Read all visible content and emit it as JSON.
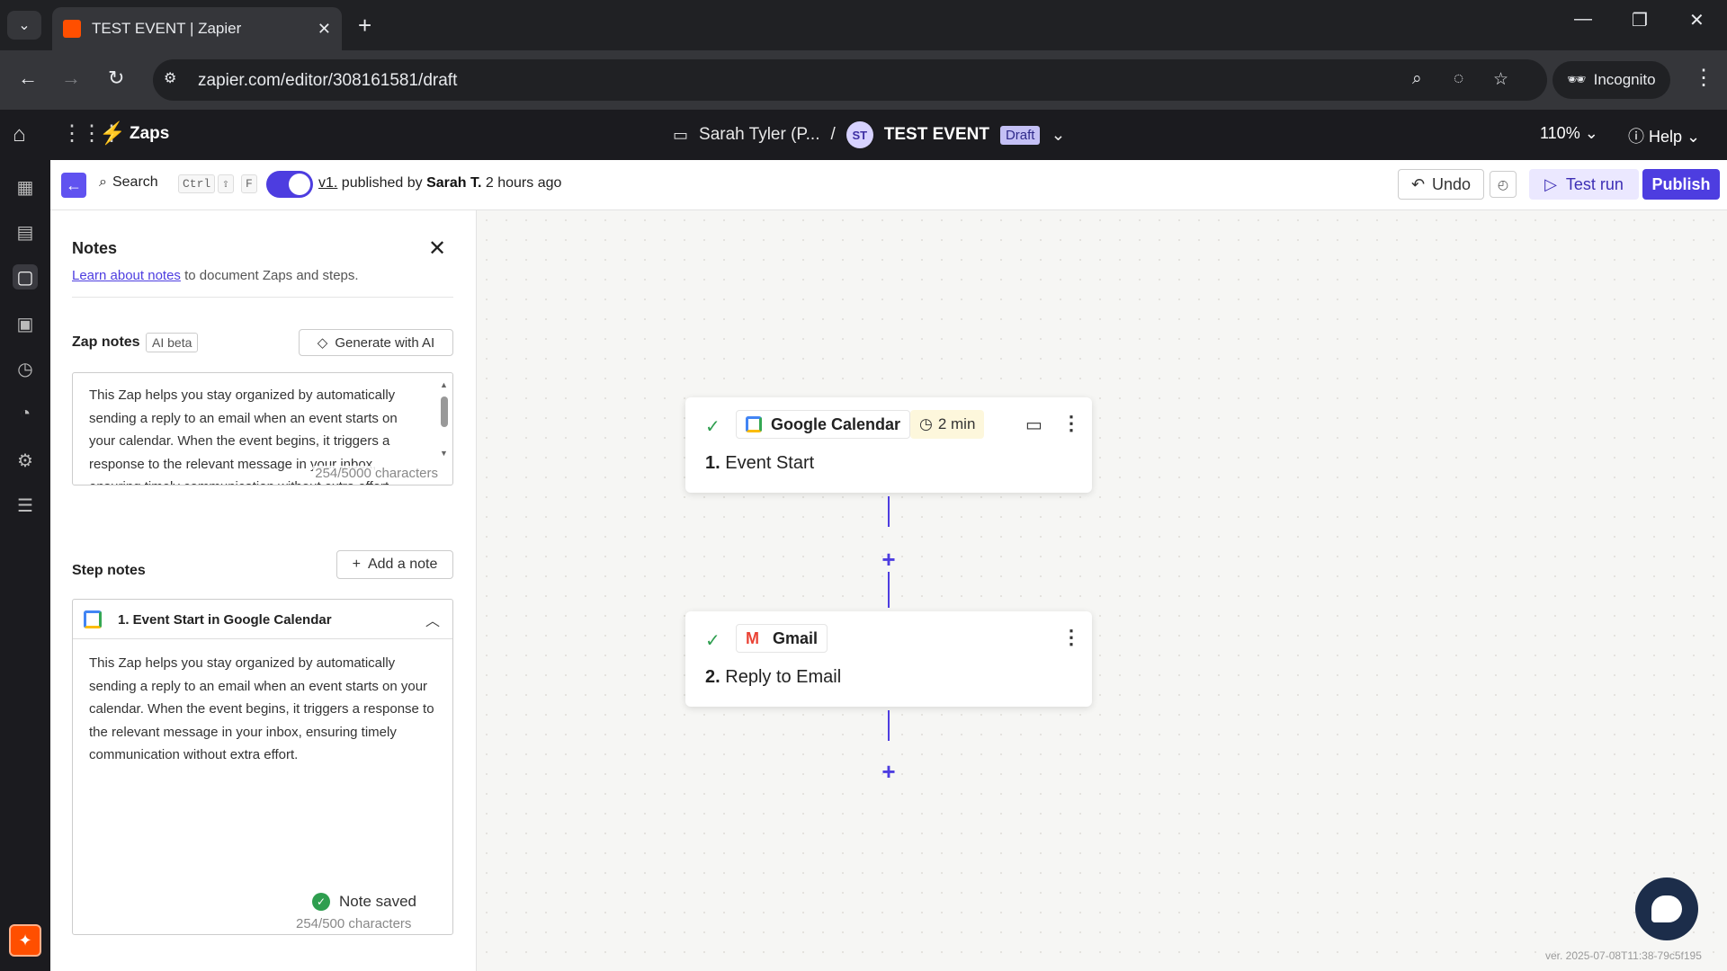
{
  "browser": {
    "tab_title": "TEST EVENT | Zapier",
    "url": "zapier.com/editor/308161581/draft",
    "incognito_label": "Incognito"
  },
  "app_header": {
    "section": "Zaps",
    "folder": "Sarah Tyler (P...",
    "avatar_initials": "ST",
    "zap_name": "TEST EVENT",
    "status_badge": "Draft",
    "zoom": "110%",
    "help": "Help"
  },
  "editor_bar": {
    "search_label": "Search",
    "kbd_ctrl": "Ctrl",
    "kbd_shift": "⇧",
    "kbd_f": "F",
    "version": "v1.",
    "published_by_text": " published by ",
    "publisher": "Sarah T.",
    "time_ago": " 2 hours ago",
    "undo": "Undo",
    "test_run": "Test run",
    "publish": "Publish"
  },
  "notes_panel": {
    "title": "Notes",
    "learn_link": "Learn about notes",
    "learn_suffix": " to document Zaps and steps.",
    "zap_notes_label": "Zap notes",
    "ai_beta": "AI beta",
    "generate_ai": "Generate with AI",
    "zap_note_text": "This Zap helps you stay organized by automatically sending a reply to an email when an event starts on your calendar. When the event begins, it triggers a response to the relevant message in your inbox, ensuring timely communication without extra effort.",
    "zap_note_count": "254/5000 characters",
    "step_notes_label": "Step notes",
    "add_note": "Add a note",
    "step_card_title": "1. Event Start in Google Calendar",
    "step_note_text": "This Zap helps you stay organized by automatically sending a reply to an email when an event starts on your calendar. When the event begins, it triggers a response to the relevant message in your inbox, ensuring timely communication without extra effort.",
    "note_saved": "Note saved",
    "step_note_count": "254/500 characters"
  },
  "canvas": {
    "steps": [
      {
        "number": "1.",
        "title": "Event Start",
        "app": "Google Calendar",
        "time": "2 min",
        "status": "complete"
      },
      {
        "number": "2.",
        "title": "Reply to Email",
        "app": "Gmail",
        "status": "complete"
      }
    ],
    "version_footer": "ver. 2025-07-08T11:38-79c5f195"
  },
  "colors": {
    "brand_orange": "#ff4f00",
    "accent_purple": "#4d3de0",
    "success_green": "#2e9e4f"
  }
}
